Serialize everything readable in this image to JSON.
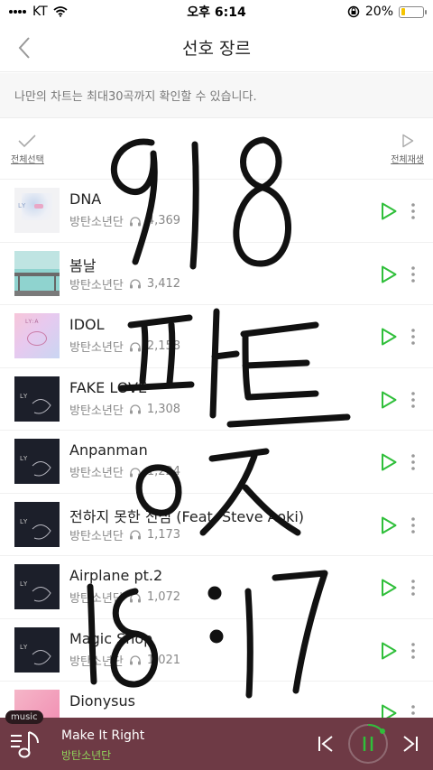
{
  "status": {
    "carrier": "KT",
    "time": "오후 6:14",
    "battery_pct": "20%",
    "battery_fraction": 0.2
  },
  "header": {
    "title": "선호 장르"
  },
  "notice": "나만의 차트는 최대30곡까지 확인할 수 있습니다.",
  "actions": {
    "select_all": "전체선택",
    "play_all": "전체재생"
  },
  "tracks": [
    {
      "title": "DNA",
      "artist": "방탄소년단",
      "plays": "4,369",
      "cover": "dna"
    },
    {
      "title": "봄날",
      "artist": "방탄소년단",
      "plays": "3,412",
      "cover": "spring"
    },
    {
      "title": "IDOL",
      "artist": "방탄소년단",
      "plays": "2,158",
      "cover": "idol"
    },
    {
      "title": "FAKE LOVE",
      "artist": "방탄소년단",
      "plays": "1,308",
      "cover": "dark"
    },
    {
      "title": "Anpanman",
      "artist": "방탄소년단",
      "plays": "1,224",
      "cover": "dark"
    },
    {
      "title": "전하지 못한 진심 (Feat. Steve Aoki)",
      "artist": "방탄소년단",
      "plays": "1,173",
      "cover": "dark"
    },
    {
      "title": "Airplane pt.2",
      "artist": "방탄소년단",
      "plays": "1,072",
      "cover": "dark"
    },
    {
      "title": "Magic Shop",
      "artist": "방탄소년단",
      "plays": "1,021",
      "cover": "dark"
    },
    {
      "title": "Dionysus",
      "artist": "방탄소년단",
      "plays": "",
      "cover": "pink"
    }
  ],
  "player": {
    "tag": "music",
    "title": "Make It Right",
    "artist": "방탄소년단"
  },
  "handwriting": [
    "9/8",
    "파트",
    "o ス",
    "18:17"
  ],
  "colors": {
    "accent_green": "#2fbf3a",
    "player_bg": "#6e3a45",
    "player_artist": "#8fd35a"
  }
}
